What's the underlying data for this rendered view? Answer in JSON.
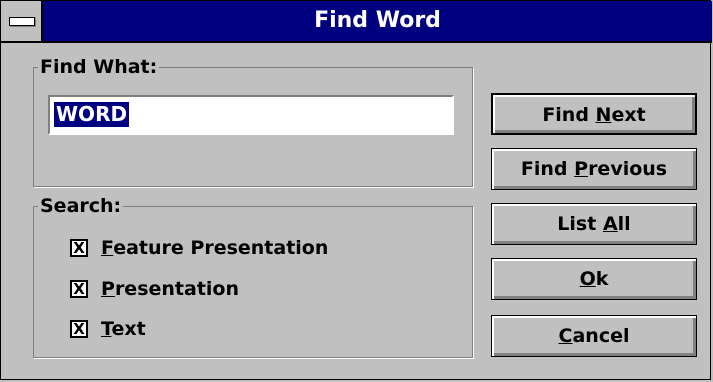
{
  "window": {
    "title": "Find Word"
  },
  "find_group": {
    "label": "Find What:",
    "input_value": "WORD"
  },
  "search_group": {
    "label": "Search:",
    "options": [
      {
        "label": "Feature Presentation",
        "mnemonic": "F",
        "rest": "eature Presentation",
        "checked": true,
        "mark": "X"
      },
      {
        "label": "Presentation",
        "mnemonic": "P",
        "rest": "resentation",
        "checked": true,
        "mark": "X"
      },
      {
        "label": "Text",
        "mnemonic": "T",
        "rest": "ext",
        "checked": true,
        "mark": "X"
      }
    ]
  },
  "buttons": {
    "find_next": {
      "label": "Find Next",
      "pre": "Find ",
      "mnemonic": "N",
      "post": "ext"
    },
    "find_previous": {
      "label": "Find Previous",
      "pre": "Find ",
      "mnemonic": "P",
      "post": "revious"
    },
    "list_all": {
      "label": "List All",
      "pre": "List ",
      "mnemonic": "A",
      "post": "ll"
    },
    "ok": {
      "label": "Ok",
      "pre": "",
      "mnemonic": "O",
      "post": "k"
    },
    "cancel": {
      "label": "Cancel",
      "pre": "",
      "mnemonic": "C",
      "post": "ancel"
    }
  }
}
